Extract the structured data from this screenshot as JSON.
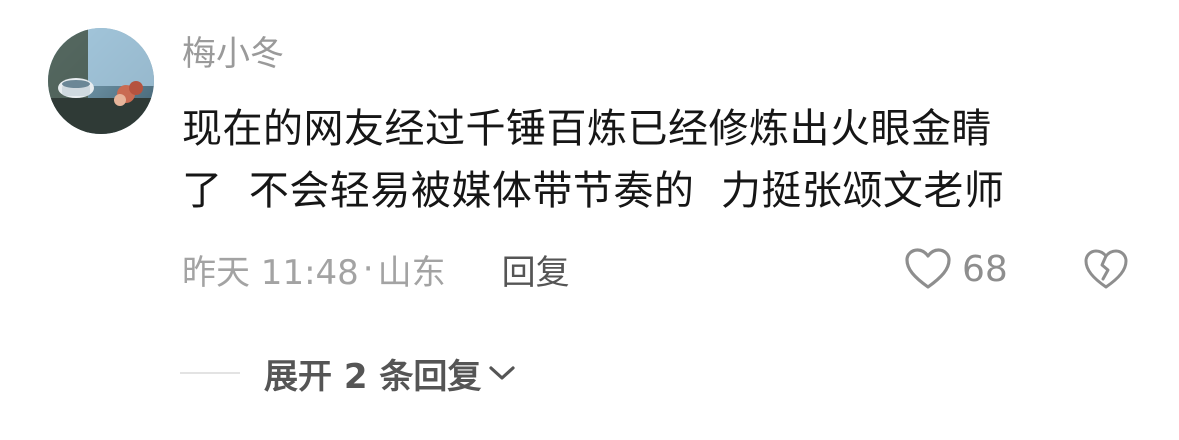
{
  "comment": {
    "username": "梅小冬",
    "text_lines": [
      "现在的网友经过千锤百炼已经修炼出火眼金睛",
      "了  不会轻易被媒体带节奏的  力挺张颂文老师"
    ],
    "time": "昨天 11:48",
    "separator": "·",
    "location": "山东",
    "reply_label": "回复",
    "like_count": "68",
    "expand_label": "展开 2 条回复"
  },
  "icons": {
    "avatar": "avatar-photo",
    "like": "heart-outline-icon",
    "dislike": "broken-heart-icon",
    "expand": "chevron-down-icon"
  },
  "colors": {
    "username": "#9a9a9a",
    "body_text": "#161616",
    "meta_text": "#a3a3a3",
    "action_text": "#555555",
    "icon_gray": "#8e8e8e"
  }
}
